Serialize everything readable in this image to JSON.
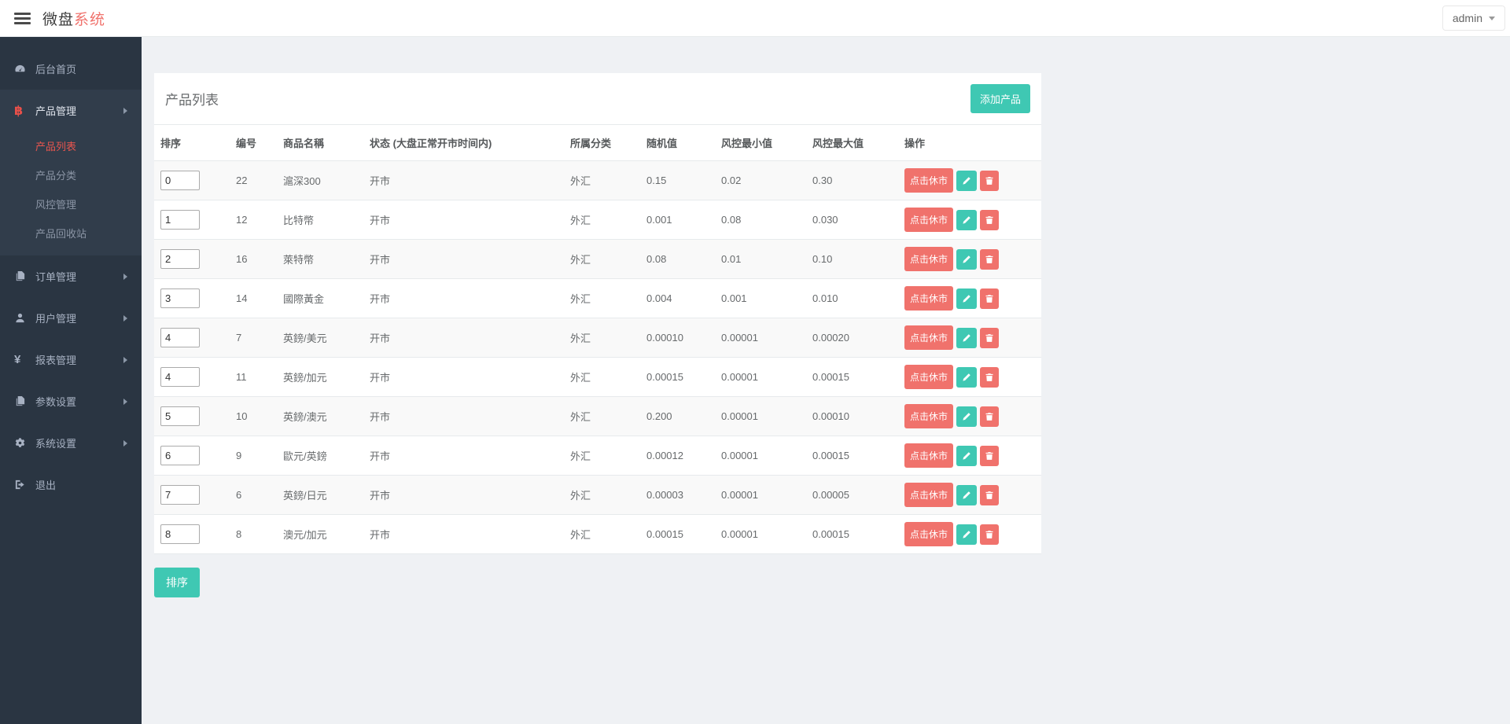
{
  "header": {
    "logo": {
      "primary": "微盘",
      "accent": "系统"
    },
    "user": {
      "name": "admin"
    }
  },
  "sidebar": {
    "items": [
      {
        "id": "dashboard",
        "label": "后台首页",
        "icon": "dashboard-icon"
      },
      {
        "id": "product-management",
        "label": "产品管理",
        "icon": "bitcoin-icon",
        "expanded": true,
        "children": [
          {
            "label": "产品列表",
            "active": true
          },
          {
            "label": "产品分类",
            "active": false
          },
          {
            "label": "风控管理",
            "active": false
          },
          {
            "label": "产品回收站",
            "active": false
          }
        ]
      },
      {
        "id": "order-management",
        "label": "订单管理",
        "icon": "documents-icon"
      },
      {
        "id": "user-management",
        "label": "用户管理",
        "icon": "user-icon"
      },
      {
        "id": "report-management",
        "label": "报表管理",
        "icon": "yen-icon"
      },
      {
        "id": "parameter-settings",
        "label": "参数设置",
        "icon": "documents-icon"
      },
      {
        "id": "system-settings",
        "label": "系统设置",
        "icon": "gears-icon"
      },
      {
        "id": "logout",
        "label": "退出",
        "icon": "sign-out-icon"
      }
    ]
  },
  "panel": {
    "title": "产品列表",
    "add_button_label": "添加产品",
    "sort_button_label": "排序",
    "table": {
      "headers": [
        "排序",
        "编号",
        "商品名稱",
        "状态 (大盘正常开市时间内)",
        "所属分类",
        "随机值",
        "风控最小值",
        "风控最大值",
        "操作"
      ],
      "action_close_label": "点击休市",
      "rows": [
        {
          "sort": "0",
          "id": "22",
          "name": "滬深300",
          "status": "开市",
          "category": "外汇",
          "random": "0.15",
          "risk_min": "0.02",
          "risk_max": "0.30"
        },
        {
          "sort": "1",
          "id": "12",
          "name": "比特幣",
          "status": "开市",
          "category": "外汇",
          "random": "0.001",
          "risk_min": "0.08",
          "risk_max": "0.030"
        },
        {
          "sort": "2",
          "id": "16",
          "name": "萊特幣",
          "status": "开市",
          "category": "外汇",
          "random": "0.08",
          "risk_min": "0.01",
          "risk_max": "0.10"
        },
        {
          "sort": "3",
          "id": "14",
          "name": "國際黃金",
          "status": "开市",
          "category": "外汇",
          "random": "0.004",
          "risk_min": "0.001",
          "risk_max": "0.010"
        },
        {
          "sort": "4",
          "id": "7",
          "name": "英鎊/美元",
          "status": "开市",
          "category": "外汇",
          "random": "0.00010",
          "risk_min": "0.00001",
          "risk_max": "0.00020"
        },
        {
          "sort": "4",
          "id": "11",
          "name": "英鎊/加元",
          "status": "开市",
          "category": "外汇",
          "random": "0.00015",
          "risk_min": "0.00001",
          "risk_max": "0.00015"
        },
        {
          "sort": "5",
          "id": "10",
          "name": "英鎊/澳元",
          "status": "开市",
          "category": "外汇",
          "random": "0.200",
          "risk_min": "0.00001",
          "risk_max": "0.00010"
        },
        {
          "sort": "6",
          "id": "9",
          "name": "歐元/英鎊",
          "status": "开市",
          "category": "外汇",
          "random": "0.00012",
          "risk_min": "0.00001",
          "risk_max": "0.00015"
        },
        {
          "sort": "7",
          "id": "6",
          "name": "英鎊/日元",
          "status": "开市",
          "category": "外汇",
          "random": "0.00003",
          "risk_min": "0.00001",
          "risk_max": "0.00005"
        },
        {
          "sort": "8",
          "id": "8",
          "name": "澳元/加元",
          "status": "开市",
          "category": "外汇",
          "random": "0.00015",
          "risk_min": "0.00001",
          "risk_max": "0.00015"
        }
      ]
    }
  },
  "colors": {
    "accent_teal": "#3fc8b3",
    "accent_coral": "#f0726c",
    "sidebar_bg": "#2a3542",
    "active_red": "#e8554e",
    "page_bg": "#eff1f4"
  }
}
